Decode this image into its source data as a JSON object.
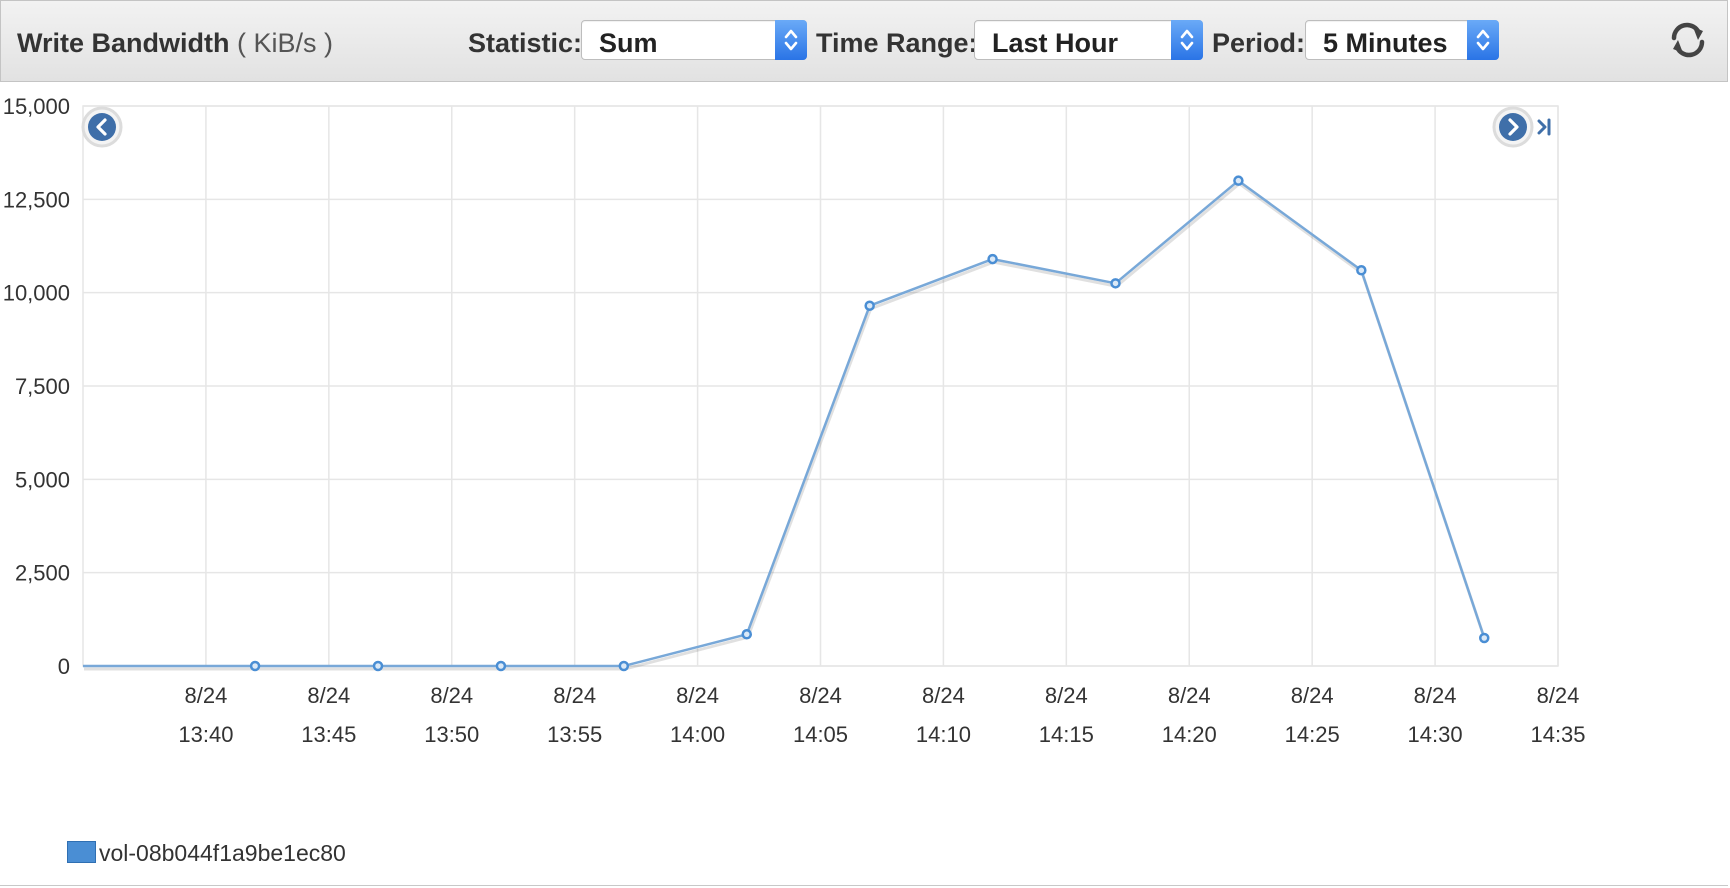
{
  "header": {
    "title": "Write Bandwidth",
    "unit": "( KiB/s )",
    "statistic_label": "Statistic:",
    "statistic_value": "Sum",
    "time_range_label": "Time Range:",
    "time_range_value": "Last Hour",
    "period_label": "Period:",
    "period_value": "5 Minutes",
    "select_arrow_icon": "up-down-chevron-icon",
    "refresh_icon": "refresh-icon"
  },
  "nav": {
    "prev_icon": "chevron-left-circle-icon",
    "next_icon": "chevron-right-circle-icon",
    "latest_icon": "skip-to-end-icon"
  },
  "colors": {
    "series": "#4a8ed4",
    "line": "#78a8d8",
    "grid": "#e6e6e6",
    "select_arrow": "#2a74e6"
  },
  "legend": {
    "label": "vol-08b044f1a9be1ec80"
  },
  "chart_data": {
    "type": "line",
    "title": "Write Bandwidth ( KiB/s )",
    "xlabel": "",
    "ylabel": "",
    "ylim": [
      0,
      15000
    ],
    "y_ticks": [
      "15,000",
      "12,500",
      "10,000",
      "7,500",
      "5,000",
      "2,500",
      "0"
    ],
    "x_ticks": [
      {
        "date": "8/24",
        "time": "13:40"
      },
      {
        "date": "8/24",
        "time": "13:45"
      },
      {
        "date": "8/24",
        "time": "13:50"
      },
      {
        "date": "8/24",
        "time": "13:55"
      },
      {
        "date": "8/24",
        "time": "14:00"
      },
      {
        "date": "8/24",
        "time": "14:05"
      },
      {
        "date": "8/24",
        "time": "14:10"
      },
      {
        "date": "8/24",
        "time": "14:15"
      },
      {
        "date": "8/24",
        "time": "14:20"
      },
      {
        "date": "8/24",
        "time": "14:25"
      },
      {
        "date": "8/24",
        "time": "14:30"
      },
      {
        "date": "8/24",
        "time": "14:35"
      }
    ],
    "grid": true,
    "legend_position": "bottom-left",
    "series": [
      {
        "name": "vol-08b044f1a9be1ec80",
        "x": [
          "13:42",
          "13:47",
          "13:52",
          "13:57",
          "14:02",
          "14:07",
          "14:12",
          "14:17",
          "14:22",
          "14:27",
          "14:32"
        ],
        "values": [
          0,
          0,
          0,
          0,
          850,
          9650,
          10900,
          10250,
          13000,
          10600,
          750
        ]
      }
    ]
  }
}
